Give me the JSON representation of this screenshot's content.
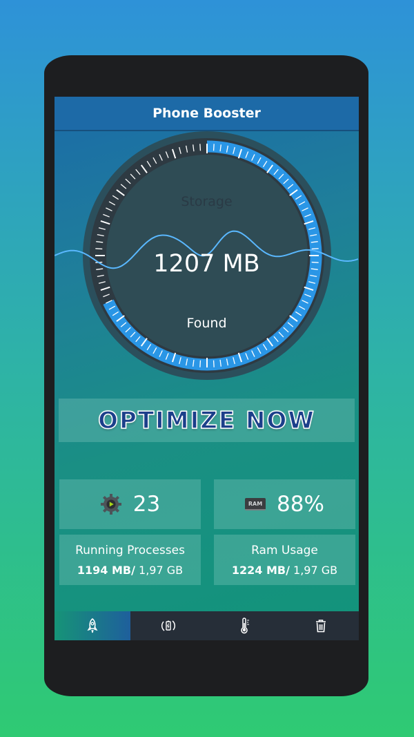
{
  "app": {
    "title": "Phone Booster"
  },
  "gauge": {
    "label_top": "Storage",
    "value": "1207 MB",
    "label_bottom": "Found",
    "progress_fraction": 0.68,
    "accent_color": "#2a96e6"
  },
  "actions": {
    "optimize_label": "OPTIMIZE  NOW"
  },
  "stats": {
    "processes": {
      "count": "23",
      "label": "Running Processes",
      "used": "1194 MB/",
      "total": " 1,97 GB",
      "icon": "gear-play-icon"
    },
    "ram": {
      "percent": "88%",
      "label": "Ram Usage",
      "used": "1224 MB/",
      "total": " 1,97 GB",
      "icon": "ram-chip-icon",
      "chip_text": "RAM"
    }
  },
  "nav": {
    "items": [
      {
        "icon": "rocket-icon",
        "active": true
      },
      {
        "icon": "battery-cycle-icon",
        "active": false
      },
      {
        "icon": "thermometer-icon",
        "active": false
      },
      {
        "icon": "trash-icon",
        "active": false
      }
    ]
  }
}
